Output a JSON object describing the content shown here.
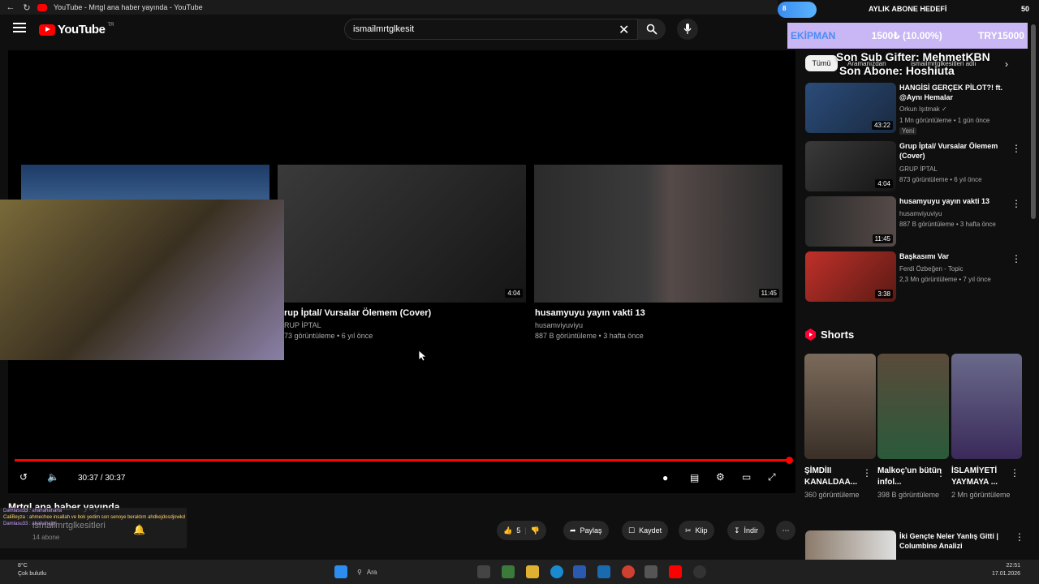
{
  "browser": {
    "tab_title": "YouTube - Mrtgl ana haber yayında - YouTube"
  },
  "header": {
    "logo_text": "YouTube",
    "logo_region": "TR",
    "search_value": "ismailmrtglkesit"
  },
  "overlay": {
    "goal_pill": "8",
    "goal_title": "AYLIK ABONE HEDEFİ",
    "goal_count": "50",
    "strip_left": "EKİPMAN",
    "strip_mid": "1500₺ (10.00%)",
    "strip_right": "TRY15000",
    "sub_gifter": "Son Sub Gifter: MehmetKBN",
    "son_abone": "Son Abone: Hoshiuta"
  },
  "player": {
    "cards": [
      {
        "title": "rup İptal/ Vursalar Ölemem (Cover)",
        "channel": "RUP İPTAL",
        "meta": "73 görüntüleme • 6 yıl önce",
        "duration": "4:04"
      },
      {
        "title": "husamyuyu yayın vakti 13",
        "channel": "husamviyuviyu",
        "meta": "887 B görüntüleme • 3 hafta önce",
        "duration": "11:45"
      }
    ],
    "time": "30:37 / 30:37"
  },
  "video": {
    "title": "Mrtgl ana haber yayında",
    "channel": "ismailmrtglkesitleri",
    "subs": "14 abone",
    "like_count": "5",
    "share_label": "Paylaş",
    "save_label": "Kaydet",
    "clip_label": "Klip",
    "download_label": "İndir"
  },
  "chat": [
    "Damlasu33 : ahahahahaha",
    "CaliBeyza : ahmechee insallah ve bok yedim son senoye beraktım ahdkejdosdjowkd",
    "Damlasu33 : ahahahajwj"
  ],
  "sidebar": {
    "chips": [
      "Tümü",
      "Aramanızdan",
      "ismailmrtglkesitleri adlı"
    ],
    "recs": [
      {
        "title": "HANGİSİ GERÇEK PİLOT?! ft. @Aynı Hemalar",
        "channel": "Orkun Işıtmak ✓",
        "meta": "1 Mn görüntüleme • 1 gün önce",
        "badge": "Yeni",
        "duration": "43:22"
      },
      {
        "title": "Grup İptal/ Vursalar Ölemem (Cover)",
        "channel": "GRUP İPTAL",
        "meta": "873 görüntüleme • 6 yıl önce",
        "badge": "",
        "duration": "4:04"
      },
      {
        "title": "husamyuyu yayın vakti 13",
        "channel": "husamviyuviyu",
        "meta": "887 B görüntüleme • 3 hafta önce",
        "badge": "",
        "duration": "11:45"
      },
      {
        "title": "Başkasımı Var",
        "channel": "Ferdi Özbeğen - Topic",
        "meta": "2,3 Mn görüntüleme • 7 yıl önce",
        "badge": "",
        "duration": "3:38"
      }
    ],
    "shorts_label": "Shorts",
    "shorts": [
      {
        "title": "ŞİMDİII KANALDAA...",
        "views": "360 görüntüleme"
      },
      {
        "title": "Malkoç'un bütün infol...",
        "views": "398 B görüntüleme"
      },
      {
        "title": "İSLAMİYETİ YAYMAYA ...",
        "views": "2 Mn görüntüleme"
      }
    ],
    "last_rec_title": "İki Gençte Neler Yanlış Gitti | Columbine Analizi"
  },
  "taskbar": {
    "weather_temp": "8°C",
    "weather_desc": "Çok bulutlu",
    "search_placeholder": "Ara",
    "time": "22:51",
    "date": "17.01.2026"
  },
  "colors": {
    "accent": "#ff0000",
    "bg": "#0f0f0f",
    "goal_strip": "#c9b6f4"
  }
}
